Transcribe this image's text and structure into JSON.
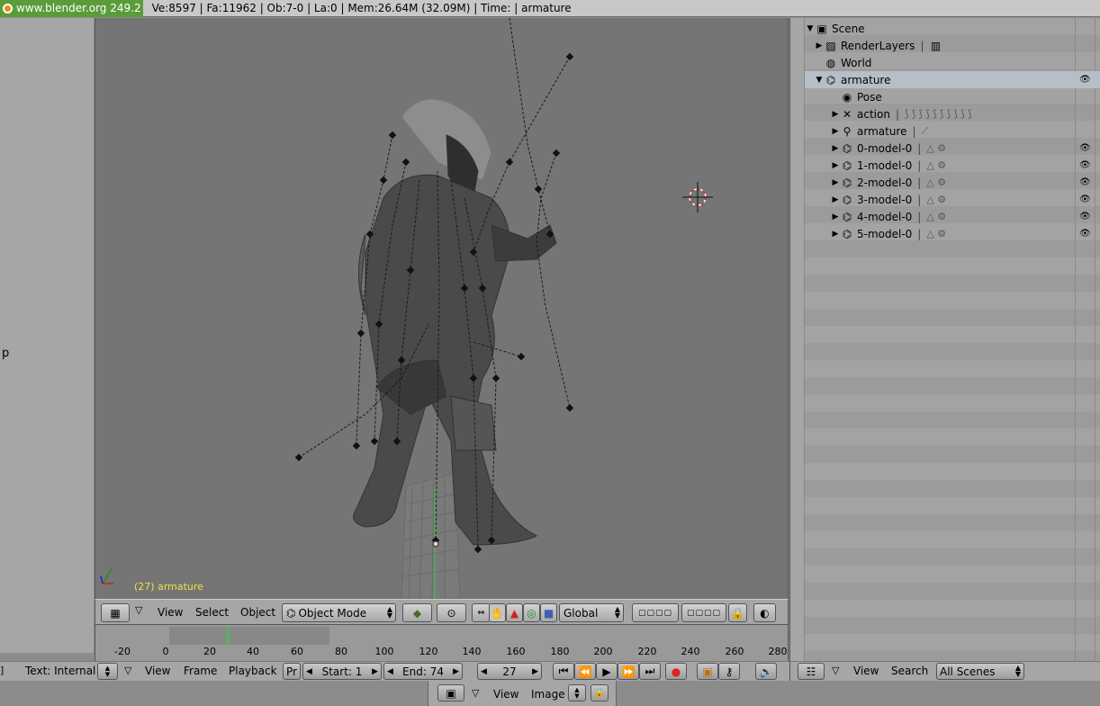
{
  "topbar": {
    "brand": "www.blender.org 249.2",
    "stats": "Ve:8597 | Fa:11962 | Ob:7-0 | La:0  | Mem:26.64M (32.09M)  | Time: | armature"
  },
  "left_panel": {
    "partial_text": "p"
  },
  "viewport": {
    "object_label": "(27) armature"
  },
  "view3d_header": {
    "menus": [
      "View",
      "Select",
      "Object"
    ],
    "mode": "Object Mode",
    "orientation": "Global"
  },
  "timeline": {
    "ticks": [
      "-20",
      "0",
      "20",
      "40",
      "60",
      "80",
      "100",
      "120",
      "140",
      "160",
      "180",
      "200",
      "220",
      "240",
      "260",
      "280"
    ],
    "current_frame": 27
  },
  "timeline_header": {
    "text_internal": "Text: Internal",
    "menus": [
      "View",
      "Frame",
      "Playback"
    ],
    "pr": "Pr",
    "start": "Start: 1",
    "end": "End: 74",
    "frame": "27"
  },
  "outliner": {
    "rows": [
      {
        "label": "Scene"
      },
      {
        "label": "RenderLayers"
      },
      {
        "label": "World"
      },
      {
        "label": "armature"
      },
      {
        "label": "Pose"
      },
      {
        "label": "action"
      },
      {
        "label": "armature"
      },
      {
        "label": "0-model-0"
      },
      {
        "label": "1-model-0"
      },
      {
        "label": "2-model-0"
      },
      {
        "label": "3-model-0"
      },
      {
        "label": "4-model-0"
      },
      {
        "label": "5-model-0"
      }
    ]
  },
  "outliner_header": {
    "menus": [
      "View",
      "Search"
    ],
    "scene_filter": "All Scenes"
  },
  "image_header": {
    "menus": [
      "View",
      "Image"
    ]
  },
  "colors": {
    "brand_green": "#5a9c3a",
    "viewport_bg": "#757575",
    "label_yellow": "#f0e040",
    "frame_line": "#3ec83e"
  }
}
